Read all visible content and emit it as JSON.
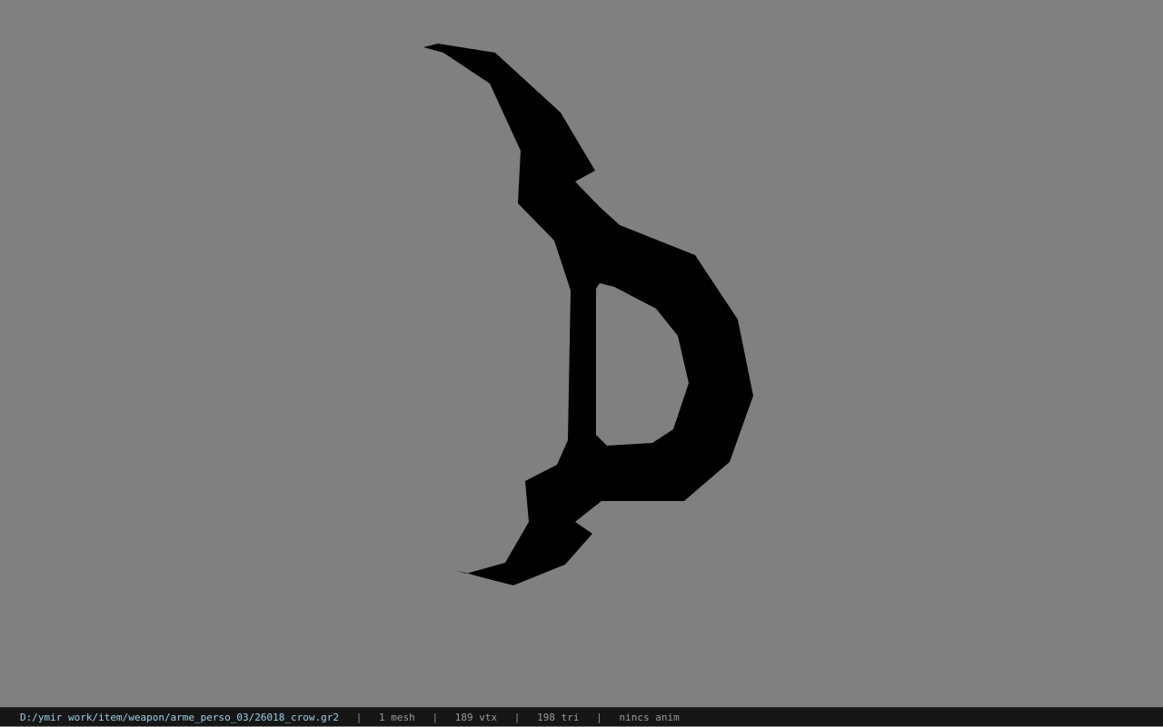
{
  "viewport": {
    "background_color": "#808080",
    "model_color": "#000000",
    "model_icon": "crow-weapon-silhouette"
  },
  "statusbar": {
    "path": "D:/ymir work/item/weapon/arme_perso_03/26018_crow.gr2",
    "separator": "|",
    "mesh": "1 mesh",
    "vertices": "189 vtx",
    "triangles": "198 tri",
    "anim": "nincs anim",
    "path_color": "#9ecfe8"
  }
}
